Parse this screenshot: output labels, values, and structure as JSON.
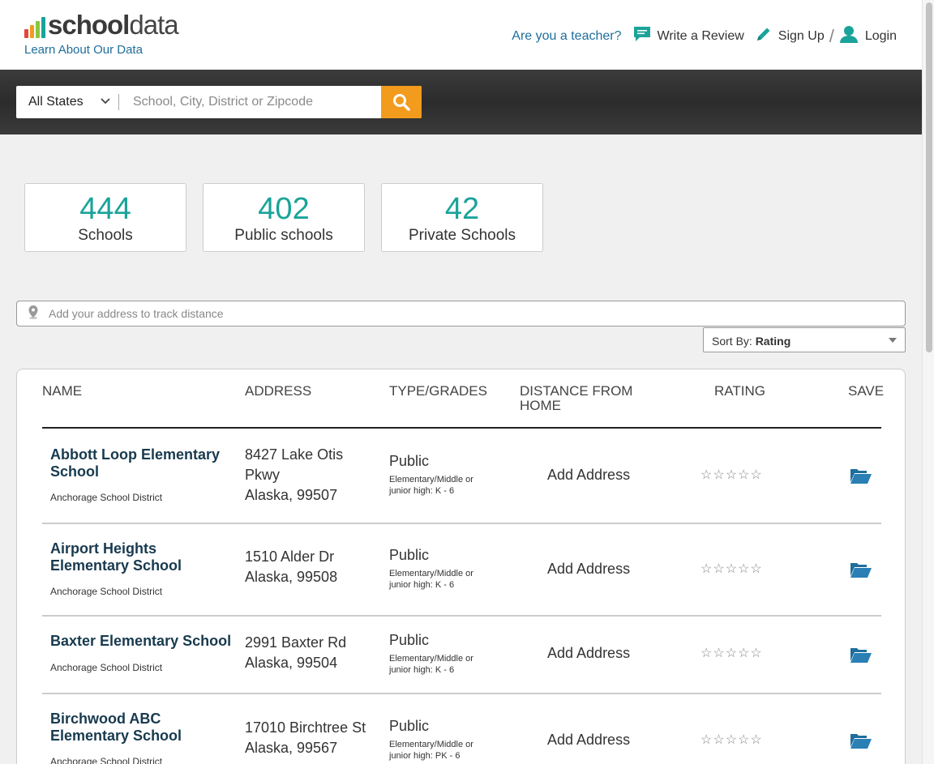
{
  "header": {
    "logo_bold": "school",
    "logo_light": "data",
    "logo_link": "Learn About Our Data",
    "teacher_link": "Are you a teacher?",
    "write_review": "Write a Review",
    "sign_up": "Sign  Up",
    "separator": "/",
    "login": "Login"
  },
  "search": {
    "state": "All States",
    "placeholder": "School, City, District or Zipcode"
  },
  "stats": [
    {
      "number": "444",
      "label": "Schools"
    },
    {
      "number": "402",
      "label": "Public schools"
    },
    {
      "number": "42",
      "label": "Private Schools"
    }
  ],
  "address_placeholder": "Add your address to track distance",
  "sort": {
    "prefix": "Sort By:",
    "value": "Rating"
  },
  "table": {
    "headers": {
      "name": "NAME",
      "address": "ADDRESS",
      "type": "TYPE/GRADES",
      "distance_1": "DISTANCE FROM",
      "distance_2": "HOME",
      "rating": "RATING",
      "save": "SAVE"
    },
    "rows": [
      {
        "name_1": "Abbott Loop Elementary",
        "name_2": "School",
        "district": "Anchorage School District",
        "addr_1": "8427 Lake Otis",
        "addr_2": "Pkwy",
        "addr_3": "Alaska, 99507",
        "type": "Public",
        "grades_1": "Elementary/Middle or",
        "grades_2": "junior high: K - 6",
        "distance": "Add Address",
        "stars": "☆☆☆☆☆"
      },
      {
        "name_1": "Airport Heights",
        "name_2": "Elementary School",
        "district": "Anchorage School District",
        "addr_1": "1510 Alder Dr",
        "addr_2": "Alaska, 99508",
        "type": "Public",
        "grades_1": "Elementary/Middle or",
        "grades_2": "junior high: K - 6",
        "distance": "Add Address",
        "stars": "☆☆☆☆☆"
      },
      {
        "name_1": "Baxter Elementary School",
        "district": "Anchorage School District",
        "addr_1": "2991 Baxter Rd",
        "addr_2": "Alaska, 99504",
        "type": "Public",
        "grades_1": "Elementary/Middle or",
        "grades_2": "junior high: K - 6",
        "distance": "Add Address",
        "stars": "☆☆☆☆☆"
      },
      {
        "name_1": "Birchwood ABC",
        "name_2": "Elementary School",
        "district": "Anchorage School District",
        "addr_1": "17010 Birchtree St",
        "addr_2": "Alaska, 99567",
        "type": "Public",
        "grades_1": "Elementary/Middle or",
        "grades_2": "junior high: PK - 6",
        "distance": "Add Address",
        "stars": "☆☆☆☆☆"
      }
    ]
  },
  "colors": {
    "accent_teal": "#1aa39a",
    "link_blue": "#1f6e9b",
    "search_orange": "#f29b1d",
    "school_name": "#183a4f",
    "folder_blue": "#2a7fb5"
  }
}
